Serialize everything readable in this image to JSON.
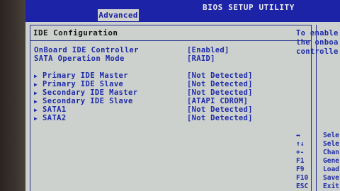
{
  "header": {
    "title": "BIOS SETUP UTILITY",
    "active_tab": "Advanced"
  },
  "main": {
    "section_title": "IDE Configuration",
    "settings": [
      {
        "label": "OnBoard IDE Controller",
        "value": "[Enabled]",
        "submenu": false
      },
      {
        "label": "SATA Operation Mode",
        "value": "[RAID]",
        "submenu": false
      },
      {
        "label": "Primary IDE Master",
        "value": "[Not Detected]",
        "submenu": true
      },
      {
        "label": "Primary IDE Slave",
        "value": "[Not Detected]",
        "submenu": true
      },
      {
        "label": "Secondary IDE Master",
        "value": "[Not Detected]",
        "submenu": true
      },
      {
        "label": "Secondary IDE Slave",
        "value": "[ATAPI CDROM]",
        "submenu": true
      },
      {
        "label": "SATA1",
        "value": "[Not Detected]",
        "submenu": true
      },
      {
        "label": "SATA2",
        "value": "[Not Detected]",
        "submenu": true
      }
    ]
  },
  "help": {
    "lines": [
      "To enable",
      "the onboa",
      "controlle"
    ]
  },
  "keys": [
    {
      "key": "↔",
      "desc": "Sele"
    },
    {
      "key": "↑↓",
      "desc": "Sele"
    },
    {
      "key": "+-",
      "desc": "Chan"
    },
    {
      "key": "F1",
      "desc": "Gene"
    },
    {
      "key": "F9",
      "desc": "Load"
    },
    {
      "key": "F10",
      "desc": "Save"
    },
    {
      "key": "ESC",
      "desc": "Exit"
    }
  ],
  "colors": {
    "header_bg": "#1d23a6",
    "panel_bg": "#cdd1cd",
    "text_blue": "#1d2aa8",
    "text_dark": "#171717"
  }
}
